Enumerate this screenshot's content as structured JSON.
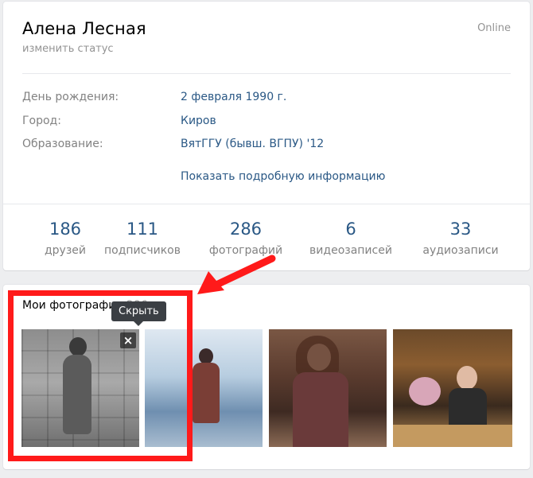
{
  "profile": {
    "name": "Алена Лесная",
    "status_link": "изменить статус",
    "online": "Online",
    "info": [
      {
        "label": "День рождения:",
        "value": "2 февраля 1990 г."
      },
      {
        "label": "Город:",
        "value": "Киров"
      },
      {
        "label": "Образование:",
        "value": "ВятГГУ (бывш. ВГПУ) '12"
      }
    ],
    "more_link": "Показать подробную информацию",
    "counters": [
      {
        "num": "186",
        "label": "друзей"
      },
      {
        "num": "111",
        "label": "подписчиков"
      },
      {
        "num": "286",
        "label": "фотографий"
      },
      {
        "num": "6",
        "label": "видеозаписей"
      },
      {
        "num": "33",
        "label": "аудиозаписи"
      }
    ]
  },
  "photos": {
    "title": "Мои фотографии",
    "count": "286",
    "tooltip": "Скрыть",
    "close_glyph": "×"
  },
  "annotation": {
    "box_color": "#ff1a1a",
    "arrow_color": "#ff1a1a"
  }
}
